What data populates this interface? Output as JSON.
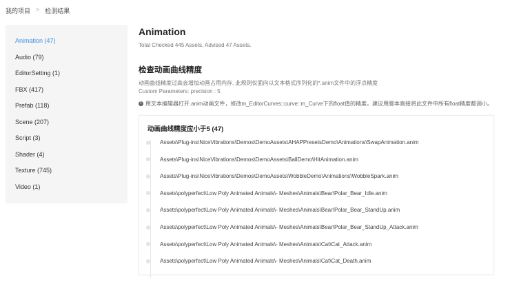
{
  "breadcrumb": {
    "items": [
      "我的项目",
      "检测结果"
    ],
    "separator": ">"
  },
  "sidebar": {
    "items": [
      {
        "label": "Animation (47)",
        "active": true
      },
      {
        "label": "Audio (79)"
      },
      {
        "label": "EditorSetting (1)"
      },
      {
        "label": "FBX (417)"
      },
      {
        "label": "Prefab (118)"
      },
      {
        "label": "Scene (207)"
      },
      {
        "label": "Script (3)"
      },
      {
        "label": "Shader (4)"
      },
      {
        "label": "Texture (745)"
      },
      {
        "label": "Video (1)"
      }
    ]
  },
  "main": {
    "title": "Animation",
    "summary": "Total Checked 445 Assets, Advised 47 Assets.",
    "rule": {
      "title": "检查动画曲线精度",
      "description": "动画曲线精度过高会增加动画占用内存, 此规则仅面向以文本格式序列化的*.anim文件中的浮点精度",
      "params": "Custom Parameters:    precision : 5",
      "tip": "用文本编辑器打开.anim动画文件，修改m_EditorCurves::curve::m_Curve下的float值的精度。建议用脚本直接将此文件中所有float精度都调小。"
    },
    "card": {
      "title": "动画曲线精度应小于5 (47)",
      "items": [
        "Assets\\Plug-ins\\NiceVibrations\\Demos\\DemoAssets\\AHAPPresetsDemo\\Animations\\SwapAnimation.anim",
        "Assets\\Plug-ins\\NiceVibrations\\Demos\\DemoAssets\\BallDemo\\HitAnimation.anim",
        "Assets\\Plug-ins\\NiceVibrations\\Demos\\DemoAssets\\WobbleDemo\\Animations\\WobbleSpark.anim",
        "Assets\\polyperfect\\Low Poly Animated Animals\\- Meshes\\Animals\\Bear\\Polar_Bear_Idle.anim",
        "Assets\\polyperfect\\Low Poly Animated Animals\\- Meshes\\Animals\\Bear\\Polar_Bear_StandUp.anim",
        "Assets\\polyperfect\\Low Poly Animated Animals\\- Meshes\\Animals\\Bear\\Polar_Bear_StandUp_Attack.anim",
        "Assets\\polyperfect\\Low Poly Animated Animals\\- Meshes\\Animals\\Cat\\Cat_Attack.anim",
        "Assets\\polyperfect\\Low Poly Animated Animals\\- Meshes\\Animals\\Cat\\Cat_Death.anim"
      ]
    }
  },
  "colors": {
    "accent": "#3d8fe0"
  }
}
